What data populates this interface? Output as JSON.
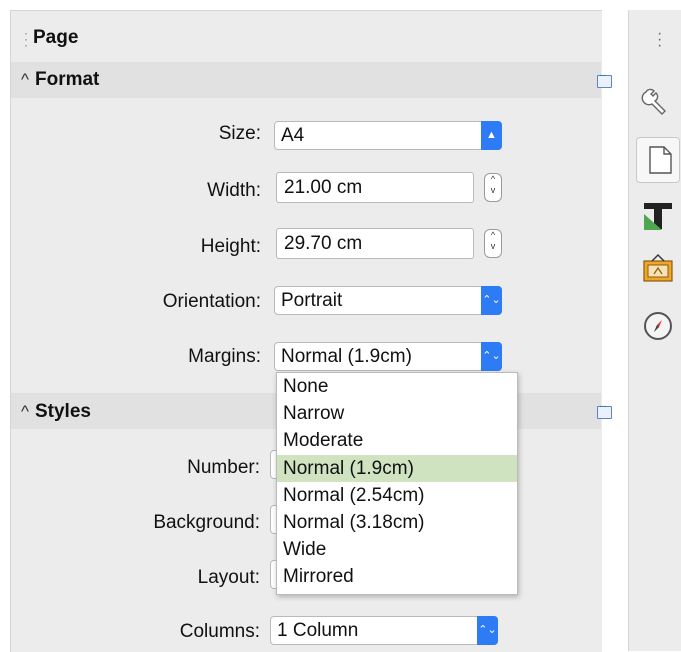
{
  "deck": {
    "title": "Page"
  },
  "format": {
    "title": "Format",
    "size_label": "Size:",
    "size_value": "A4",
    "width_label": "Width:",
    "width_value": "21.00 cm",
    "height_label": "Height:",
    "height_value": "29.70 cm",
    "orientation_label": "Orientation:",
    "orientation_value": "Portrait",
    "margins_label": "Margins:",
    "margins_value": "Normal (1.9cm)"
  },
  "margins_dropdown": {
    "options": [
      "None",
      "Narrow",
      "Moderate",
      "Normal (1.9cm)",
      "Normal (2.54cm)",
      "Normal (3.18cm)",
      "Wide",
      "Mirrored"
    ],
    "selected": "Normal (1.9cm)"
  },
  "styles": {
    "title": "Styles",
    "number_label": "Number:",
    "background_label": "Background:",
    "layout_label": "Layout:",
    "columns_label": "Columns:",
    "columns_value": "1 Column"
  },
  "tabbar": {
    "icons": [
      "properties-wrench-icon",
      "page-icon",
      "styles-icon",
      "gallery-icon",
      "navigator-icon"
    ],
    "active": "page-icon"
  },
  "colors": {
    "accent": "#2d7cf6",
    "selection": "#cfe3c1",
    "panel": "#ececec",
    "section_header": "#e1e1e1"
  }
}
